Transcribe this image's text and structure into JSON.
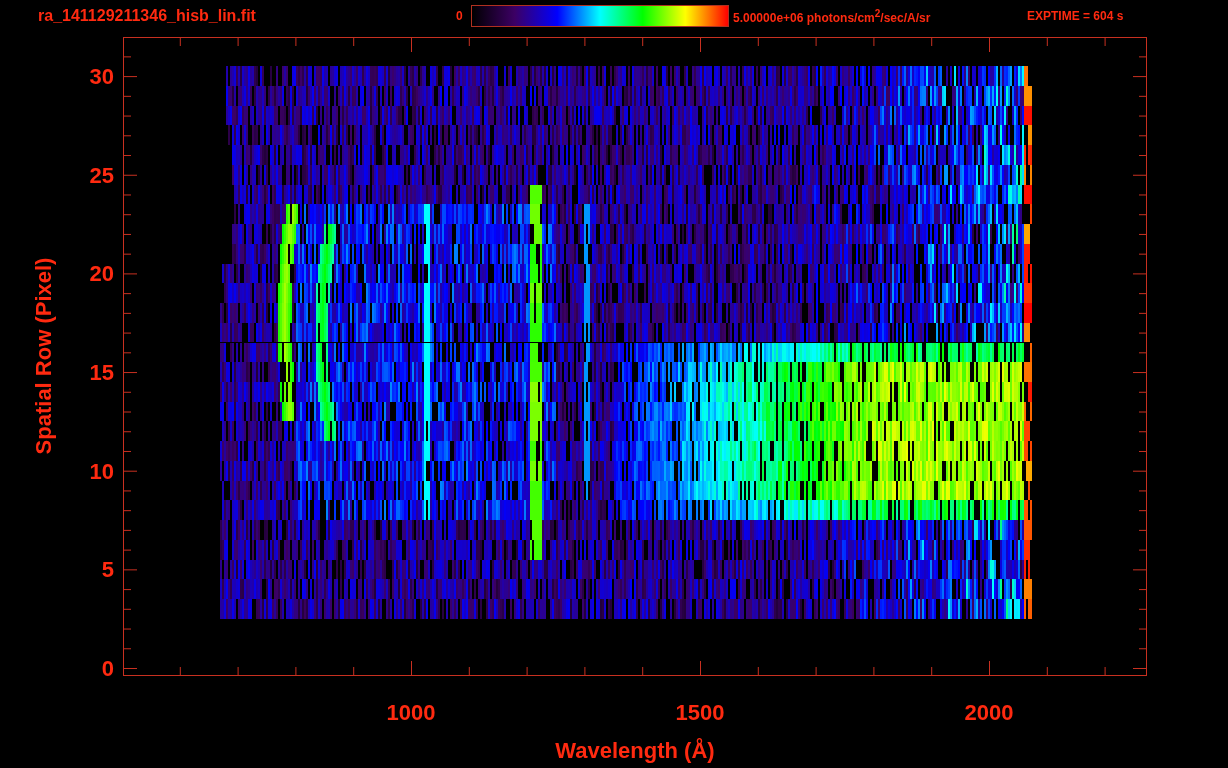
{
  "title": "ra_141129211346_hisb_lin.fit",
  "colorbar": {
    "min_label": "0",
    "max_label": "5.00000e+06 photons/cm$^{2}$/sec/A/sr"
  },
  "exposure": "EXPTIME = 604 s",
  "plot": {
    "ylabel": "Spatial Row (Pixel)",
    "xlabel": "Wavelength (Å)",
    "yticks": [
      "30",
      "25",
      "20",
      "15",
      "10",
      "5",
      "0"
    ],
    "xticks": [
      "1000",
      "1500",
      "2000"
    ]
  }
}
